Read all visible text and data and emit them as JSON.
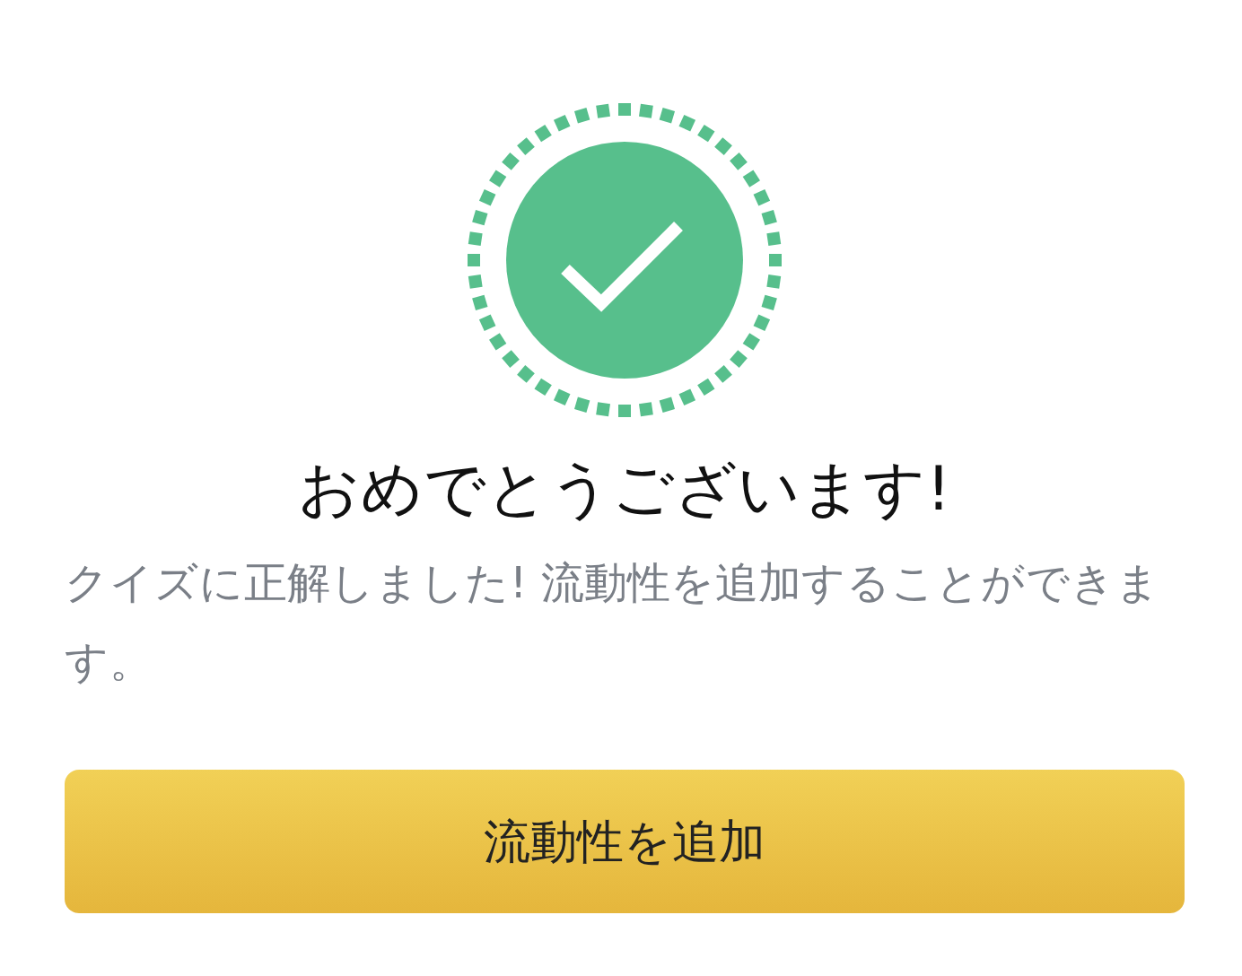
{
  "title": "おめでとうございます!",
  "message": "クイズに正解しました! 流動性を追加することができます。",
  "button": {
    "label": "流動性を追加"
  }
}
